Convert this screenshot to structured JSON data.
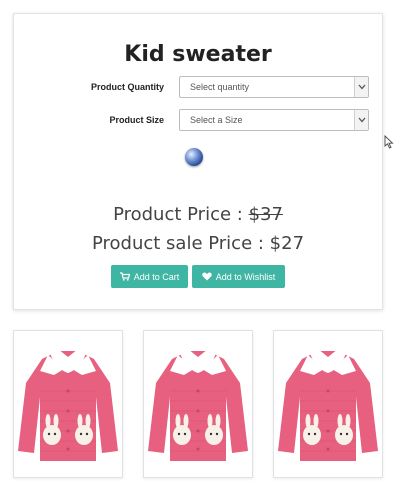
{
  "product": {
    "title": "Kid sweater",
    "quantity_label": "Product Quantity",
    "quantity_placeholder": "Select quantity",
    "size_label": "Product Size",
    "size_placeholder": "Select a Size",
    "price_prefix": "Product Price : ",
    "price_value": "$37",
    "sale_prefix": "Product sale Price : ",
    "sale_value": "$27"
  },
  "actions": {
    "add_to_cart": "Add to Cart",
    "add_to_wishlist": "Add to Wishlist"
  },
  "colors": {
    "button": "#3fb5a3",
    "sweater": "#e8607f",
    "collar": "#ffffff"
  },
  "gallery": {
    "images": [
      {
        "icon": "pink-sweater-image"
      },
      {
        "icon": "pink-sweater-image"
      },
      {
        "icon": "pink-sweater-image"
      }
    ]
  }
}
